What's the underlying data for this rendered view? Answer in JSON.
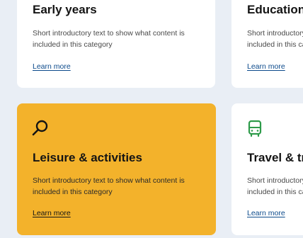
{
  "cards": [
    {
      "title": "Early years",
      "description": "Short introductory text to show what content is included in this category",
      "link": "Learn more",
      "icon": "none"
    },
    {
      "title": "Education",
      "description": "Short introductory text to show what content is included in this category",
      "link": "Learn more",
      "icon": "none"
    },
    {
      "title": "Leisure & activities",
      "description": "Short introductory text to show what content is included in this category",
      "link": "Learn more",
      "icon": "magnifier-icon"
    },
    {
      "title": "Travel & transport",
      "description": "Short introductory text to show what content is included in this category",
      "link": "Learn more",
      "icon": "bus-icon"
    }
  ],
  "colors": {
    "highlight": "#f3b22b",
    "card": "#ffffff",
    "page": "#e9eef5",
    "link": "#0b4a8b",
    "bus_icon": "#2e9b4a"
  }
}
